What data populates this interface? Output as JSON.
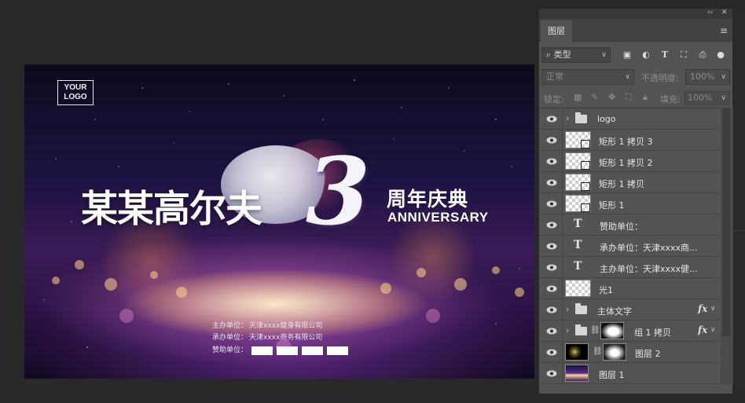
{
  "canvas": {
    "logo_line1": "YOUR",
    "logo_line2": "LOGO",
    "title_cn": "某某高尔夫",
    "big_number": "3",
    "anniv_cn": "周年庆典",
    "anniv_en": "ANNIVERSARY",
    "info": [
      {
        "label": "主办单位：",
        "value": "天津xxxx健身有限公司"
      },
      {
        "label": "承办单位：",
        "value": "天津xxxx商务有限公司"
      },
      {
        "label": "赞助单位：",
        "value": ""
      }
    ]
  },
  "panel": {
    "window_controls": [
      "‹‹",
      "✕"
    ],
    "tab_label": "图层",
    "filter": {
      "selected": "类型"
    },
    "blend_mode": "正常",
    "opacity_label": "不透明度:",
    "opacity_value": "100%",
    "lock_label": "锁定:",
    "fill_label": "填充:",
    "fill_value": "100%",
    "layers": [
      {
        "name": "logo",
        "kind": "group"
      },
      {
        "name": "矩形 1 拷贝 3",
        "kind": "shape"
      },
      {
        "name": "矩形 1 拷贝 2",
        "kind": "shape"
      },
      {
        "name": "矩形 1 拷贝",
        "kind": "shape"
      },
      {
        "name": "矩形 1",
        "kind": "shape"
      },
      {
        "name": "赞助单位：",
        "kind": "text"
      },
      {
        "name": "承办单位：天津xxxx商...",
        "kind": "text"
      },
      {
        "name": "主办单位：天津xxxx健...",
        "kind": "text"
      },
      {
        "name": "光1",
        "kind": "pixel"
      },
      {
        "name": "主体文字",
        "kind": "group",
        "fx": "fx"
      },
      {
        "name": "组 1 拷贝",
        "kind": "group-mask",
        "fx": "fx"
      },
      {
        "name": "图层 2",
        "kind": "pixel-mask"
      },
      {
        "name": "图层 1",
        "kind": "pixel-photo"
      }
    ]
  },
  "colors": {
    "app_bg": "#282828",
    "panel_bg": "#535353",
    "canvas_purple": "#3a1a55"
  }
}
